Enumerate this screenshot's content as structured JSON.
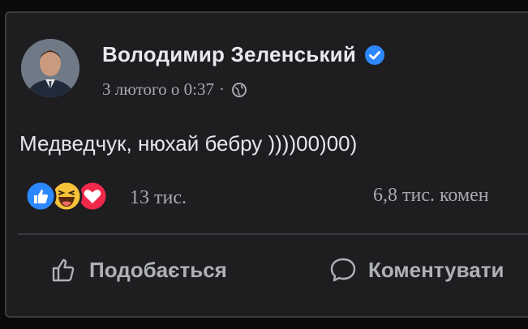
{
  "post": {
    "author": "Володимир Зеленський",
    "timestamp": "3 лютого о 0:37",
    "separator": "·",
    "text": "Медведчук, нюхай бебру ))))00)00)",
    "reaction_count": "13 тис.",
    "comments_count": "6,8 тис. комен"
  },
  "actions": {
    "like_label": "Подобається",
    "comment_label": "Коментувати"
  },
  "icons": {
    "verified": "verified-badge-icon",
    "audience": "globe-icon",
    "reactions": [
      "like-icon",
      "haha-icon",
      "love-icon"
    ],
    "like_action": "thumbs-up-icon",
    "comment_action": "comment-bubble-icon"
  },
  "colors": {
    "background": "#0b0b0c",
    "card": "#1e1e21",
    "accent_blue": "#2d88ff",
    "love_red": "#f0284a",
    "haha_yellow": "#f7c23a",
    "text_primary": "#e4e6ea",
    "text_secondary": "#a6a9ae"
  }
}
